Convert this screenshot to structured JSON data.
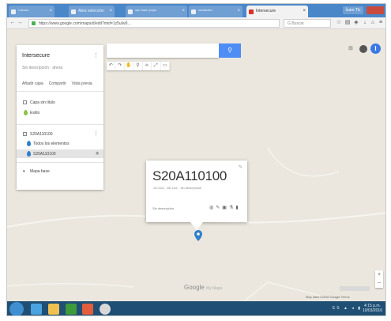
{
  "browser": {
    "tabs": [
      {
        "label": "ᴵ·ᵗᵉʳᵛᶦᵉʷ",
        "active": false
      },
      {
        "label": "Abra selección",
        "active": false
      },
      {
        "label": "ᵃᵖᵖ ᵐᵃᵖˢ ᵍᵒᵒᵍˡᵉ",
        "active": false
      },
      {
        "label": "ᵛᶦˢᵘᵃˡᶦᶻᵃᵈᵒʳ",
        "active": false
      },
      {
        "label": "Intersecure",
        "active": true
      }
    ],
    "user_chip": "Ícaro Tlc",
    "url": "https://www.google.com/maps/d/edit?mid=1z5uIw9...",
    "search_placeholder": "G Buscar"
  },
  "map": {
    "search_button_icon": "search-icon",
    "tools": [
      "↶",
      "↷",
      "✋",
      "⚲",
      "⟡",
      "⤢",
      "▭"
    ],
    "google_logo": "Google",
    "google_suffix": "My Maps",
    "map_data": "Map data ©2016 Google  Terms",
    "zoom_in": "+",
    "zoom_out": "−",
    "user_initial": "I"
  },
  "panel": {
    "title": "Intersecure",
    "subtitle": "Sin descripción · ahora",
    "actions": [
      "Añadir capa",
      "Compartir",
      "Vista previa"
    ],
    "layer1_name": "Capa sin título",
    "layer1_item": "Estilo",
    "layer2_name": "S20A110100",
    "layer2_item1": "Todos los elementos",
    "layer2_item2": "S20A110100",
    "base_map": "Mapa base"
  },
  "info_window": {
    "title": "S20A110100",
    "subtitle": "-34.1111, -58.1111 · sin descripción",
    "footer": "Sin descripción"
  },
  "taskbar": {
    "tray": "ES ▲ ◂ ▮",
    "time": "4:15 p.m.",
    "date": "10/03/2016"
  }
}
